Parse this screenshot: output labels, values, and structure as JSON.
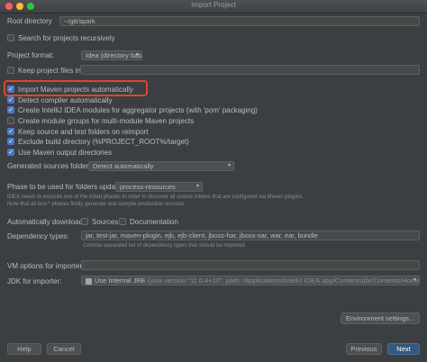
{
  "window": {
    "title": "Import Project"
  },
  "root_directory": {
    "label": "Root directory",
    "value": "~/git/spark"
  },
  "search_recursively": {
    "label": "Search for projects recursively",
    "checked": false
  },
  "project_format": {
    "label": "Project format:",
    "value": "Idea (directory based)"
  },
  "keep_project_files": {
    "label": "Keep project files in:",
    "checked": false,
    "value": ""
  },
  "options": [
    {
      "label": "Import Maven projects automatically",
      "checked": true
    },
    {
      "label": "Detect compiler automatically",
      "checked": true
    },
    {
      "label": "Create IntelliJ IDEA modules for aggregator projects (with 'pom' packaging)",
      "checked": true
    },
    {
      "label": "Create module groups for multi-module Maven projects",
      "checked": false
    },
    {
      "label": "Keep source and test folders on reimport",
      "checked": true
    },
    {
      "label": "Exclude build directory (%PROJECT_ROOT%/target)",
      "checked": true
    },
    {
      "label": "Use Maven output directories",
      "checked": true
    }
  ],
  "generated_sources": {
    "label": "Generated sources folders:",
    "value": "Detect automatically"
  },
  "phase": {
    "label": "Phase to be used for folders update:",
    "value": "process-resources",
    "hint1": "IDEA needs to execute one of the listed phases in order to discover all source folders that are configured via Maven plugins.",
    "hint2": "Note that all test-* phases firstly generate and compile production sources."
  },
  "auto_download": {
    "label": "Automatically download:",
    "sources_label": "Sources",
    "sources_checked": false,
    "docs_label": "Documentation",
    "docs_checked": false
  },
  "dependency_types": {
    "label": "Dependency types:",
    "value": "jar, test-jar, maven-plugin, ejb, ejb-client, jboss-har, jboss-sar, war, ear, bundle",
    "hint": "Comma separated list of dependency types that should be imported"
  },
  "vm_options": {
    "label": "VM options for importer:",
    "value": ""
  },
  "jdk": {
    "label": "JDK for importer:",
    "value_main": "Use Internal JRE",
    "value_detail": "(java version \"11.0.4+10\", path: /Applications/IntelliJ IDEA.app/Contents/jbr/Contents/Home)"
  },
  "buttons": {
    "environment": "Environment settings...",
    "help": "Help",
    "cancel": "Cancel",
    "previous": "Previous",
    "next": "Next"
  },
  "colors": {
    "accent": "#4c78c2",
    "highlight": "#e0442d",
    "primary_button": "#365880"
  }
}
